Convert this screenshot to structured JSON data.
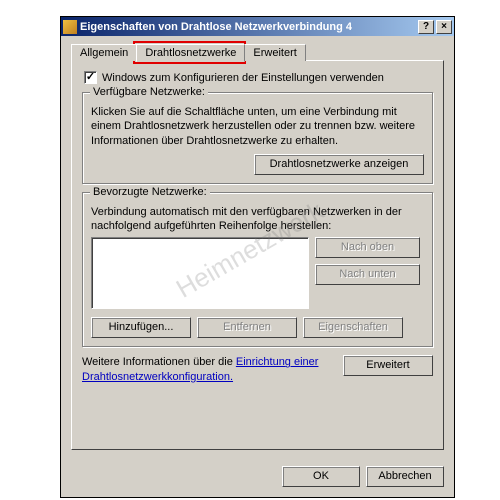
{
  "title": "Eigenschaften von Drahtlose Netzwerkverbindung 4",
  "titlebar": {
    "help": "?",
    "close": "×"
  },
  "tabs": {
    "general": "Allgemein",
    "wireless": "Drahtlosnetzwerke",
    "advanced": "Erweitert"
  },
  "checkbox": {
    "mark": "✓",
    "label": "Windows zum Konfigurieren der Einstellungen verwenden"
  },
  "group1": {
    "label": "Verfügbare Netzwerke:",
    "text": "Klicken Sie auf die Schaltfläche unten, um eine Verbindung mit einem Drahtlosnetzwerk herzustellen oder zu trennen bzw. weitere Informationen über Drahtlosnetzwerke zu erhalten.",
    "button": "Drahtlosnetzwerke anzeigen"
  },
  "group2": {
    "label": "Bevorzugte Netzwerke:",
    "text": "Verbindung automatisch mit den verfügbaren Netzwerken in der nachfolgend aufgeführten Reihenfolge herstellen:",
    "up": "Nach oben",
    "down": "Nach unten",
    "add": "Hinzufügen...",
    "remove": "Entfernen",
    "props": "Eigenschaften"
  },
  "info": {
    "text": "Weitere Informationen über die ",
    "link": "Einrichtung einer Drahtlosnetzwerkkonfiguration.",
    "button": "Erweitert"
  },
  "buttons": {
    "ok": "OK",
    "cancel": "Abbrechen"
  },
  "watermark": "Heimnetzwerk"
}
